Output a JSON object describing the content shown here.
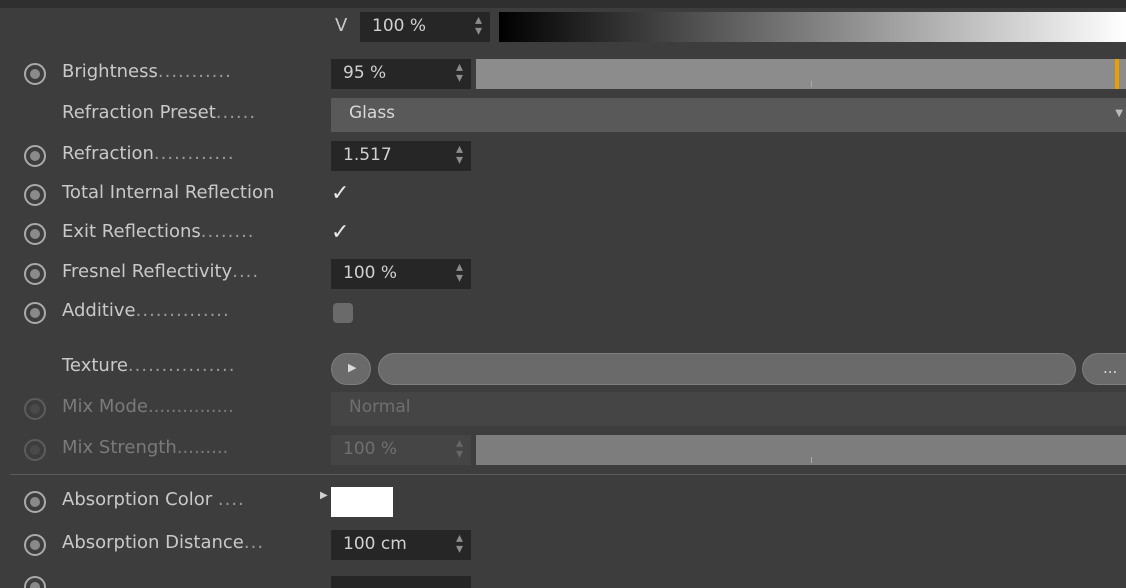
{
  "v_row": {
    "label": "V",
    "value": "100 %"
  },
  "brightness": {
    "label": "Brightness",
    "dots": "...........",
    "value": "95 %",
    "slider_level": 0.95,
    "accent": "#e8a000"
  },
  "refraction_preset": {
    "label": "Refraction Preset",
    "dots": "......",
    "value": "Glass"
  },
  "refraction": {
    "label": "Refraction",
    "dots": "............",
    "value": "1.517"
  },
  "total_internal_reflection": {
    "label": "Total Internal Reflection",
    "check": "✓"
  },
  "exit_reflections": {
    "label": "Exit Reflections",
    "dots": "........",
    "check": "✓"
  },
  "fresnel_reflectivity": {
    "label": "Fresnel Reflectivity",
    "dots": "....",
    "value": "100 %"
  },
  "additive": {
    "label": "Additive",
    "dots": "..............",
    "checked": false
  },
  "texture": {
    "label": "Texture",
    "dots": "................",
    "more": "..."
  },
  "mix_mode": {
    "label": "Mix Mode",
    "dots": "...............",
    "value": "Normal"
  },
  "mix_strength": {
    "label": "Mix Strength",
    "dots": ".........",
    "value": "100 %"
  },
  "absorption_color": {
    "label": "Absorption Color",
    "dots": "....",
    "swatch_color": "#ffffff"
  },
  "absorption_distance": {
    "label": "Absorption Distance",
    "dots": "...",
    "value": "100 cm"
  }
}
